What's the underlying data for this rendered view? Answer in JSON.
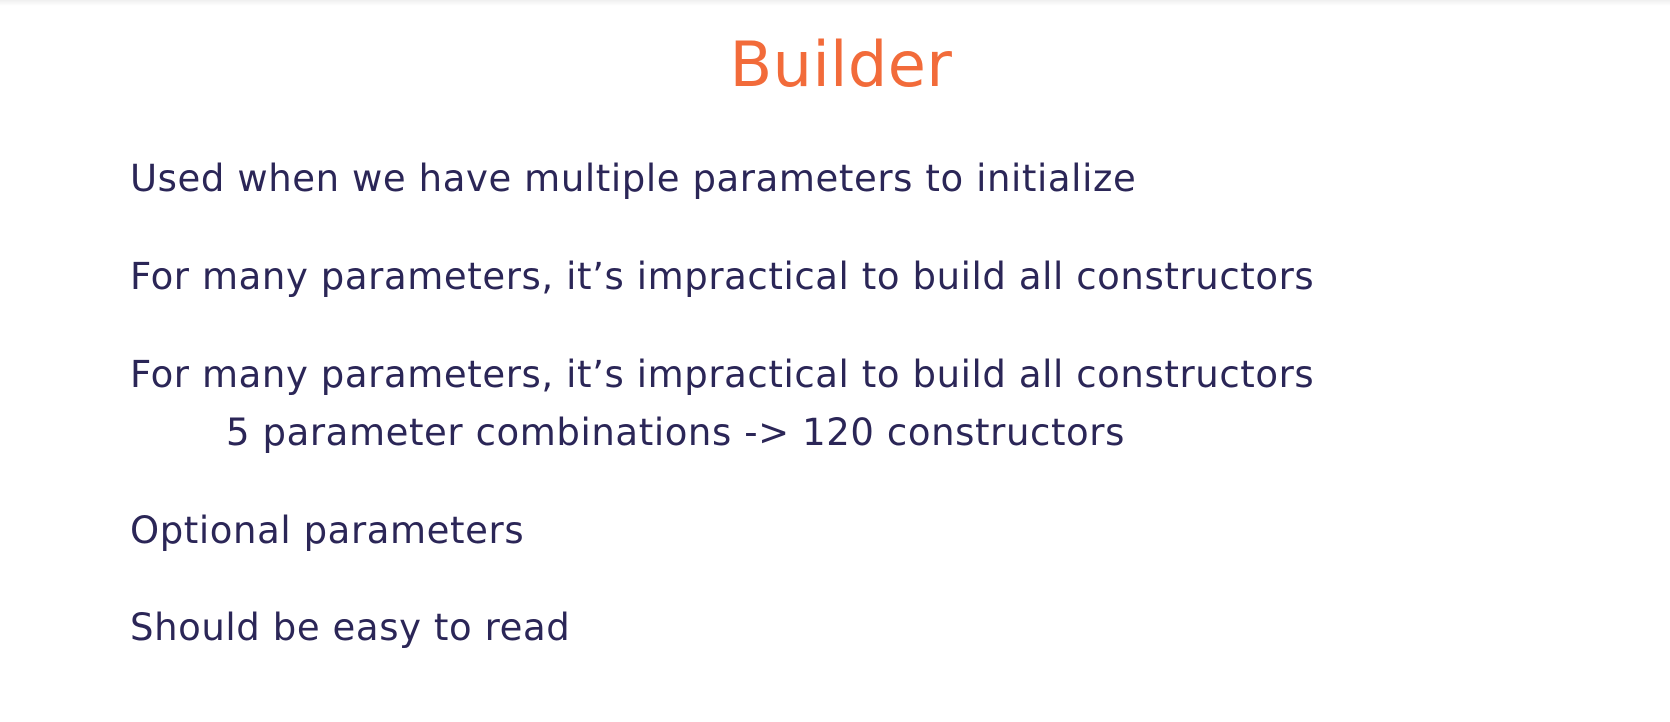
{
  "slide": {
    "title": "Builder",
    "bullets": [
      "Used when we have multiple parameters to initialize",
      "For many parameters, it’s impractical to build all constructors",
      "For many parameters, it’s impractical to build all constructors",
      "5 parameter combinations -> 120 constructors",
      "Optional parameters",
      "Should be easy to read"
    ],
    "colors": {
      "title": "#f26b3a",
      "text": "#2b2657",
      "background": "#ffffff"
    }
  }
}
